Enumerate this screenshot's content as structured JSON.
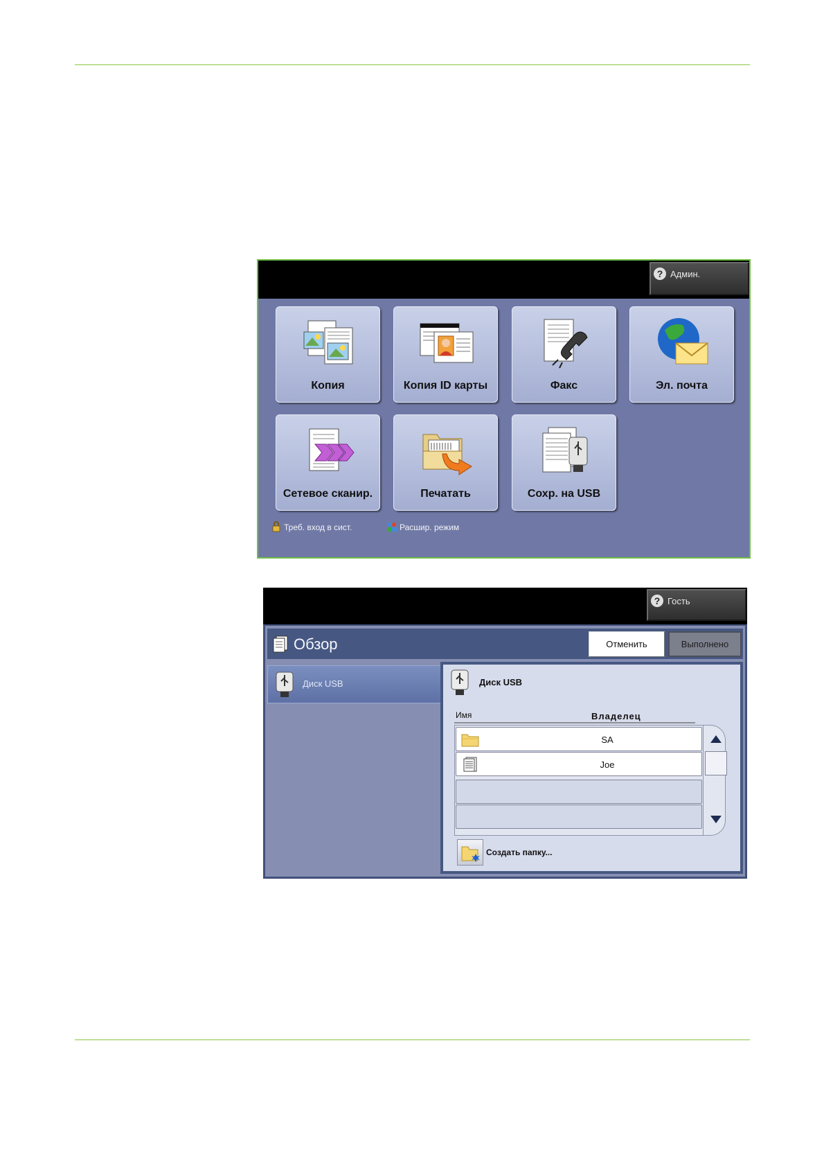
{
  "home": {
    "admin_label": "Админ.",
    "tiles": [
      {
        "label": "Копия",
        "icon": "copy-icon"
      },
      {
        "label": "Копия ID карты",
        "icon": "id-card-copy-icon"
      },
      {
        "label": "Факс",
        "icon": "fax-icon"
      },
      {
        "label": "Эл. почта",
        "icon": "email-icon"
      },
      {
        "label": "Сетевое сканир.",
        "icon": "network-scan-icon"
      },
      {
        "label": "Печатать",
        "icon": "print-icon"
      },
      {
        "label": "Сохр. на USB",
        "icon": "store-to-usb-icon"
      }
    ],
    "footer": {
      "login_required": "Треб. вход в сист.",
      "advanced_mode": "Расшир. режим"
    }
  },
  "browse": {
    "guest_label": "Гость",
    "title": "Обзор",
    "cancel_label": "Отменить",
    "done_label": "Выполнено",
    "left_item": "Диск USB",
    "location_title": "Диск USB",
    "columns": {
      "name": "Имя",
      "owner": "Владелец"
    },
    "rows": [
      {
        "type": "folder",
        "icon": "folder-icon",
        "owner": "SA"
      },
      {
        "type": "file",
        "icon": "document-icon",
        "owner": "Joe"
      }
    ],
    "new_folder_label": "Создать папку..."
  },
  "colors": {
    "rule": "#8dc63f",
    "home_bg": "#7079a6",
    "browse_header": "#465882"
  }
}
